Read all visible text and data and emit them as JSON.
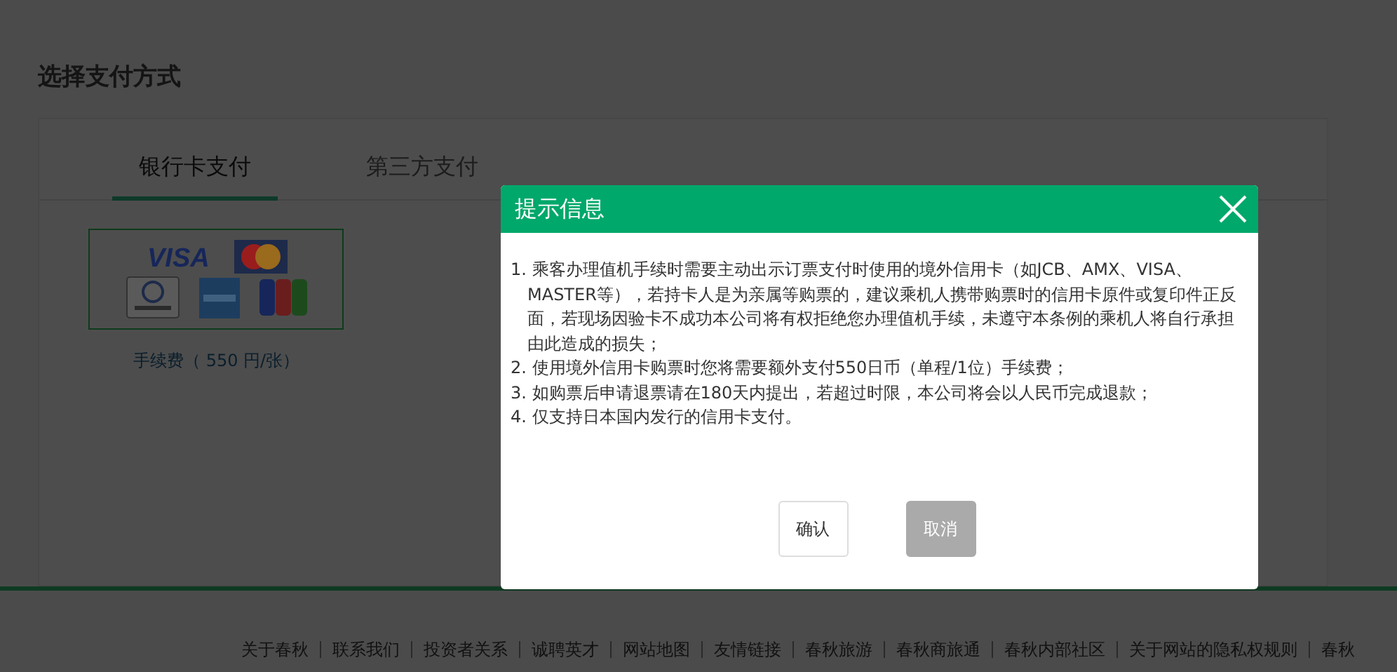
{
  "page": {
    "title": "选择支付方式",
    "tabs": [
      {
        "label": "银行卡支付",
        "selected": true
      },
      {
        "label": "第三方支付",
        "selected": false
      }
    ],
    "card_option": {
      "selected": true,
      "logos": [
        {
          "kind": "visa",
          "label": "VISA"
        },
        {
          "kind": "mastercard"
        },
        {
          "kind": "diners"
        },
        {
          "kind": "amex"
        },
        {
          "kind": "jcb"
        }
      ],
      "fee": "手续费（ 550 円/张）"
    }
  },
  "dialog": {
    "title": "提示信息",
    "items": [
      "1. 乘客办理值机手续时需要主动出示订票支付时使用的境外信用卡（如JCB、AMX、VISA、MASTER等），若持卡人是为亲属等购票的，建议乘机人携带购票时的信用卡原件或复印件正反面，若现场因验卡不成功本公司将有权拒绝您办理值机手续，未遵守本条例的乘机人将自行承担由此造成的损失；",
      "2. 使用境外信用卡购票时您将需要额外支付550日币（单程/1位）手续费；",
      "3. 如购票后申请退票请在180天内提出，若超过时限，本公司将会以人民币完成退款；",
      "4. 仅支持日本国内发行的信用卡支付。"
    ],
    "buttons": [
      {
        "label": "确认",
        "kind": "primary"
      },
      {
        "label": "取消",
        "kind": "secondary"
      }
    ]
  },
  "footer": {
    "links": [
      "关于春秋",
      "联系我们",
      "投资者关系",
      "诚聘英才",
      "网站地图",
      "友情链接",
      "春秋旅游",
      "春秋商旅通",
      "春秋内部社区",
      "关于网站的隐私权规则",
      "春秋"
    ]
  }
}
